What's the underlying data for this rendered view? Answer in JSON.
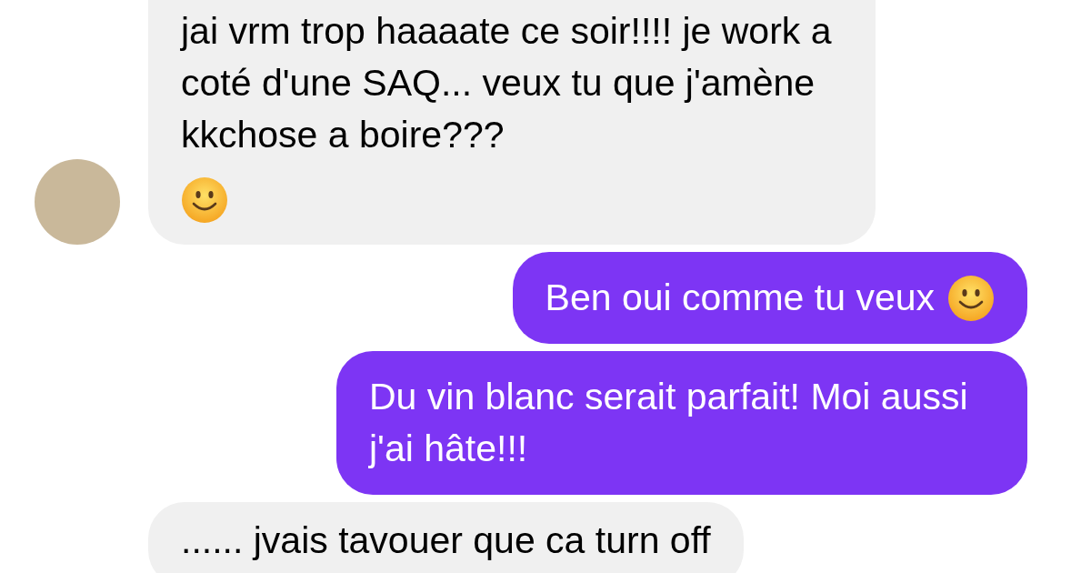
{
  "messages": [
    {
      "kind": "incoming",
      "text": "jai vrm trop haaaate ce soir!!!! je work a coté d'une SAQ... veux tu que j'amène kkchose a boire???",
      "emoji": true,
      "avatar": true
    },
    {
      "kind": "outgoing",
      "text": "Ben oui comme tu veux",
      "emoji": true,
      "avatar": false
    },
    {
      "kind": "outgoing",
      "text": "Du vin blanc serait parfait! Moi aussi j'ai hâte!!!",
      "emoji": false,
      "avatar": false
    },
    {
      "kind": "incoming",
      "text": "...... jvais tavouer que ca turn off",
      "emoji": false,
      "avatar": false
    }
  ]
}
